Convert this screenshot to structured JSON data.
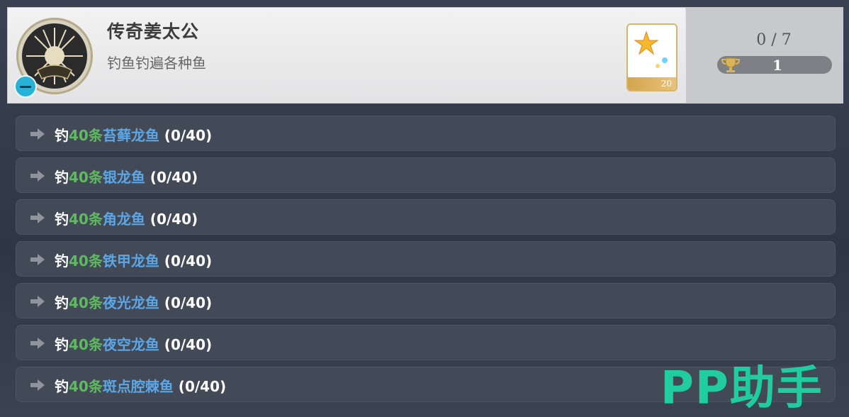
{
  "achievement": {
    "title": "传奇姜太公",
    "description": "钓鱼钓遍各种鱼",
    "reward_count": "20",
    "progress": "0 / 7",
    "score": "1"
  },
  "tasks": [
    {
      "verb": "钓",
      "count": "40条",
      "fish": "苔藓龙鱼",
      "progress": " (0/40)"
    },
    {
      "verb": "钓",
      "count": "40条",
      "fish": "银龙鱼",
      "progress": " (0/40)"
    },
    {
      "verb": "钓",
      "count": "40条",
      "fish": "角龙鱼",
      "progress": " (0/40)"
    },
    {
      "verb": "钓",
      "count": "40条",
      "fish": "铁甲龙鱼",
      "progress": " (0/40)"
    },
    {
      "verb": "钓",
      "count": "40条",
      "fish": "夜光龙鱼",
      "progress": " (0/40)"
    },
    {
      "verb": "钓",
      "count": "40条",
      "fish": "夜空龙鱼",
      "progress": " (0/40)"
    },
    {
      "verb": "钓",
      "count": "40条",
      "fish": "斑点腔棘鱼",
      "progress": " (0/40)"
    }
  ],
  "watermark": "PP助手",
  "colors": {
    "count_green": "#5fb95f",
    "fish_blue": "#5aa6e6",
    "watermark_teal": "#1fd3a4"
  }
}
